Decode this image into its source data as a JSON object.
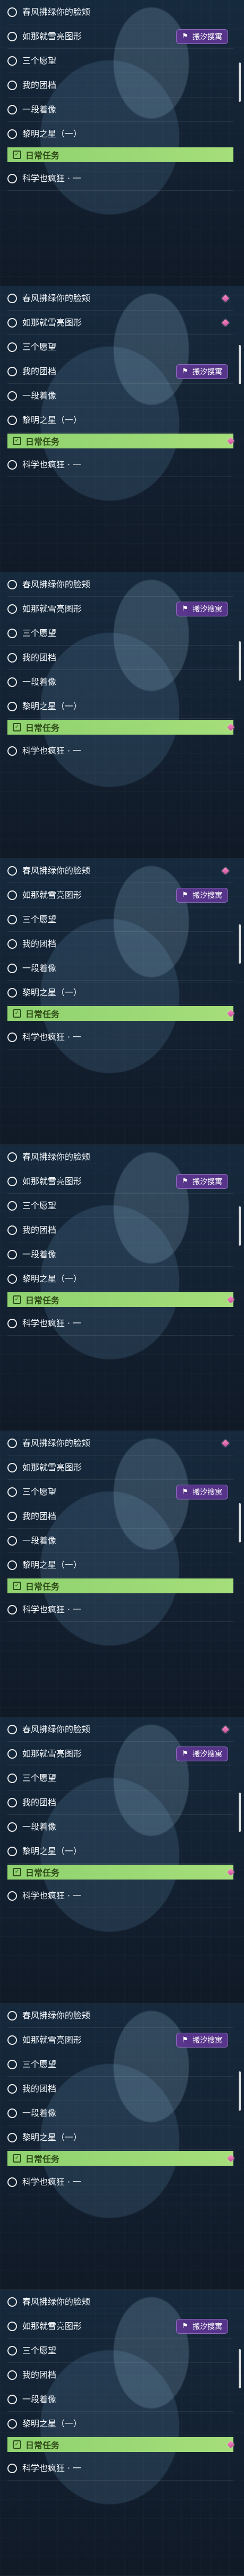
{
  "task_list": {
    "panels": [
      {
        "items": [
          {
            "label": "春风拂绿你的脸颊",
            "badge": "",
            "diamond": false
          },
          {
            "label": "如那就雪亮图形",
            "badge": "搬汐搜寓",
            "diamond": false
          },
          {
            "label": "三个愿望",
            "badge": "",
            "diamond": false
          },
          {
            "label": "我的团档",
            "badge": "",
            "diamond": false
          },
          {
            "label": "一段着像",
            "badge": "",
            "diamond": false
          },
          {
            "label": "黎明之星（一）",
            "badge": "",
            "diamond": false
          },
          {
            "label": "日常任务",
            "badge": "",
            "diamond": false,
            "section": true
          },
          {
            "label": "科学也疯狂 · 一",
            "badge": "",
            "diamond": false
          }
        ]
      },
      {
        "items": [
          {
            "label": "春风拂绿你的脸颊",
            "badge": "",
            "diamond": true
          },
          {
            "label": "如那就雪亮图形",
            "badge": "",
            "diamond": true
          },
          {
            "label": "三个愿望",
            "badge": "",
            "diamond": false
          },
          {
            "label": "我的团档",
            "badge": "搬汐搜寓",
            "diamond": false
          },
          {
            "label": "一段着像",
            "badge": "",
            "diamond": false
          },
          {
            "label": "黎明之星（一）",
            "badge": "",
            "diamond": false
          },
          {
            "label": "日常任务",
            "badge": "",
            "diamond": true,
            "section": true
          },
          {
            "label": "科学也疯狂 · 一",
            "badge": "",
            "diamond": false
          }
        ]
      },
      {
        "items": [
          {
            "label": "春风拂绿你的脸颊",
            "badge": "",
            "diamond": false
          },
          {
            "label": "如那就雪亮图形",
            "badge": "搬汐搜寓",
            "diamond": false
          },
          {
            "label": "三个愿望",
            "badge": "",
            "diamond": false
          },
          {
            "label": "我的团档",
            "badge": "",
            "diamond": false
          },
          {
            "label": "一段着像",
            "badge": "",
            "diamond": false
          },
          {
            "label": "黎明之星（一）",
            "badge": "",
            "diamond": false
          },
          {
            "label": "日常任务",
            "badge": "",
            "diamond": true,
            "section": true
          },
          {
            "label": "科学也疯狂 · 一",
            "badge": "",
            "diamond": false
          }
        ]
      },
      {
        "items": [
          {
            "label": "春风拂绿你的脸颊",
            "badge": "",
            "diamond": true
          },
          {
            "label": "如那就雪亮图形",
            "badge": "搬汐搜寓",
            "diamond": false
          },
          {
            "label": "三个愿望",
            "badge": "",
            "diamond": false
          },
          {
            "label": "我的团档",
            "badge": "",
            "diamond": false
          },
          {
            "label": "一段着像",
            "badge": "",
            "diamond": false
          },
          {
            "label": "黎明之星（一）",
            "badge": "",
            "diamond": false
          },
          {
            "label": "日常任务",
            "badge": "",
            "diamond": true,
            "section": true
          },
          {
            "label": "科学也疯狂 · 一",
            "badge": "",
            "diamond": false
          }
        ]
      },
      {
        "items": [
          {
            "label": "春风拂绿你的脸颊",
            "badge": "",
            "diamond": false
          },
          {
            "label": "如那就雪亮图形",
            "badge": "搬汐搜寓",
            "diamond": false
          },
          {
            "label": "三个愿望",
            "badge": "",
            "diamond": false
          },
          {
            "label": "我的团档",
            "badge": "",
            "diamond": false
          },
          {
            "label": "一段着像",
            "badge": "",
            "diamond": false
          },
          {
            "label": "黎明之星（一）",
            "badge": "",
            "diamond": false
          },
          {
            "label": "日常任务",
            "badge": "",
            "diamond": true,
            "section": true
          },
          {
            "label": "科学也疯狂 · 一",
            "badge": "",
            "diamond": false
          }
        ]
      },
      {
        "items": [
          {
            "label": "春风拂绿你的脸颊",
            "badge": "",
            "diamond": true
          },
          {
            "label": "如那就雪亮图形",
            "badge": "",
            "diamond": false
          },
          {
            "label": "三个愿望",
            "badge": "搬汐搜寓",
            "diamond": false
          },
          {
            "label": "我的团档",
            "badge": "",
            "diamond": false
          },
          {
            "label": "一段着像",
            "badge": "",
            "diamond": false
          },
          {
            "label": "黎明之星（一）",
            "badge": "",
            "diamond": false
          },
          {
            "label": "日常任务",
            "badge": "",
            "diamond": false,
            "section": true
          },
          {
            "label": "科学也疯狂 · 一",
            "badge": "",
            "diamond": false
          }
        ]
      },
      {
        "items": [
          {
            "label": "春风拂绿你的脸颊",
            "badge": "",
            "diamond": true
          },
          {
            "label": "如那就雪亮图形",
            "badge": "搬汐搜寓",
            "diamond": false
          },
          {
            "label": "三个愿望",
            "badge": "",
            "diamond": false
          },
          {
            "label": "我的团档",
            "badge": "",
            "diamond": false
          },
          {
            "label": "一段着像",
            "badge": "",
            "diamond": false
          },
          {
            "label": "黎明之星（一）",
            "badge": "",
            "diamond": false
          },
          {
            "label": "日常任务",
            "badge": "",
            "diamond": true,
            "section": true
          },
          {
            "label": "科学也疯狂 · 一",
            "badge": "",
            "diamond": false
          }
        ]
      },
      {
        "items": [
          {
            "label": "春风拂绿你的脸颊",
            "badge": "",
            "diamond": false
          },
          {
            "label": "如那就雪亮图形",
            "badge": "搬汐搜寓",
            "diamond": false
          },
          {
            "label": "三个愿望",
            "badge": "",
            "diamond": false
          },
          {
            "label": "我的团档",
            "badge": "",
            "diamond": false
          },
          {
            "label": "一段着像",
            "badge": "",
            "diamond": false
          },
          {
            "label": "黎明之星（一）",
            "badge": "",
            "diamond": false
          },
          {
            "label": "日常任务",
            "badge": "",
            "diamond": true,
            "section": true
          },
          {
            "label": "科学也疯狂 · 一",
            "badge": "",
            "diamond": false
          }
        ]
      },
      {
        "items": [
          {
            "label": "春风拂绿你的脸颊",
            "badge": "",
            "diamond": false
          },
          {
            "label": "如那就雪亮图形",
            "badge": "搬汐搜寓",
            "diamond": false
          },
          {
            "label": "三个愿望",
            "badge": "",
            "diamond": false
          },
          {
            "label": "我的团档",
            "badge": "",
            "diamond": false
          },
          {
            "label": "一段着像",
            "badge": "",
            "diamond": false
          },
          {
            "label": "黎明之星（一）",
            "badge": "",
            "diamond": false
          },
          {
            "label": "日常任务",
            "badge": "",
            "diamond": true,
            "section": true
          },
          {
            "label": "科学也疯狂 · 一",
            "badge": "",
            "diamond": false
          }
        ]
      }
    ]
  }
}
